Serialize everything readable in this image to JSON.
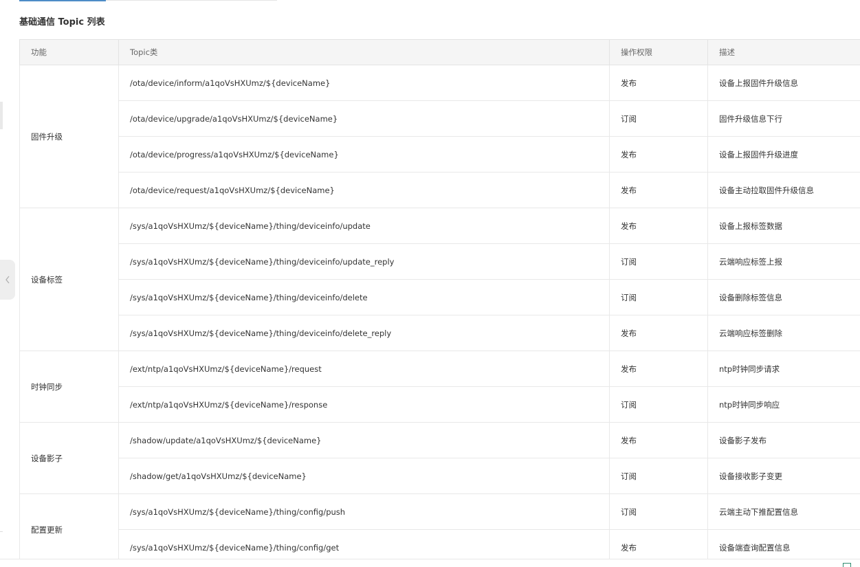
{
  "section": {
    "title": "基础通信 Topic 列表"
  },
  "table": {
    "headers": [
      "功能",
      "Topic类",
      "操作权限",
      "描述"
    ],
    "groups": [
      {
        "name": "固件升级",
        "rows": [
          {
            "topic": "/ota/device/inform/a1qoVsHXUmz/${deviceName}",
            "permission": "发布",
            "description": "设备上报固件升级信息"
          },
          {
            "topic": "/ota/device/upgrade/a1qoVsHXUmz/${deviceName}",
            "permission": "订阅",
            "description": "固件升级信息下行"
          },
          {
            "topic": "/ota/device/progress/a1qoVsHXUmz/${deviceName}",
            "permission": "发布",
            "description": "设备上报固件升级进度"
          },
          {
            "topic": "/ota/device/request/a1qoVsHXUmz/${deviceName}",
            "permission": "发布",
            "description": "设备主动拉取固件升级信息"
          }
        ]
      },
      {
        "name": "设备标签",
        "rows": [
          {
            "topic": "/sys/a1qoVsHXUmz/${deviceName}/thing/deviceinfo/update",
            "permission": "发布",
            "description": "设备上报标签数据"
          },
          {
            "topic": "/sys/a1qoVsHXUmz/${deviceName}/thing/deviceinfo/update_reply",
            "permission": "订阅",
            "description": "云端响应标签上报"
          },
          {
            "topic": "/sys/a1qoVsHXUmz/${deviceName}/thing/deviceinfo/delete",
            "permission": "订阅",
            "description": "设备删除标签信息"
          },
          {
            "topic": "/sys/a1qoVsHXUmz/${deviceName}/thing/deviceinfo/delete_reply",
            "permission": "发布",
            "description": "云端响应标签删除"
          }
        ]
      },
      {
        "name": "时钟同步",
        "rows": [
          {
            "topic": "/ext/ntp/a1qoVsHXUmz/${deviceName}/request",
            "permission": "发布",
            "description": "ntp时钟同步请求"
          },
          {
            "topic": "/ext/ntp/a1qoVsHXUmz/${deviceName}/response",
            "permission": "订阅",
            "description": "ntp时钟同步响应"
          }
        ]
      },
      {
        "name": "设备影子",
        "rows": [
          {
            "topic": "/shadow/update/a1qoVsHXUmz/${deviceName}",
            "permission": "发布",
            "description": "设备影子发布"
          },
          {
            "topic": "/shadow/get/a1qoVsHXUmz/${deviceName}",
            "permission": "订阅",
            "description": "设备接收影子变更"
          }
        ]
      },
      {
        "name": "配置更新",
        "rows": [
          {
            "topic": "/sys/a1qoVsHXUmz/${deviceName}/thing/config/push",
            "permission": "订阅",
            "description": "云端主动下推配置信息"
          },
          {
            "topic": "/sys/a1qoVsHXUmz/${deviceName}/thing/config/get",
            "permission": "发布",
            "description": "设备端查询配置信息"
          }
        ]
      }
    ]
  },
  "icons": {
    "collapse_handle": "chevron-left-icon",
    "corner": "window-icon"
  },
  "colors": {
    "tab_indicator": "#4d8cc7",
    "header_bg": "#f5f5f5",
    "border": "#e8e8e8"
  }
}
